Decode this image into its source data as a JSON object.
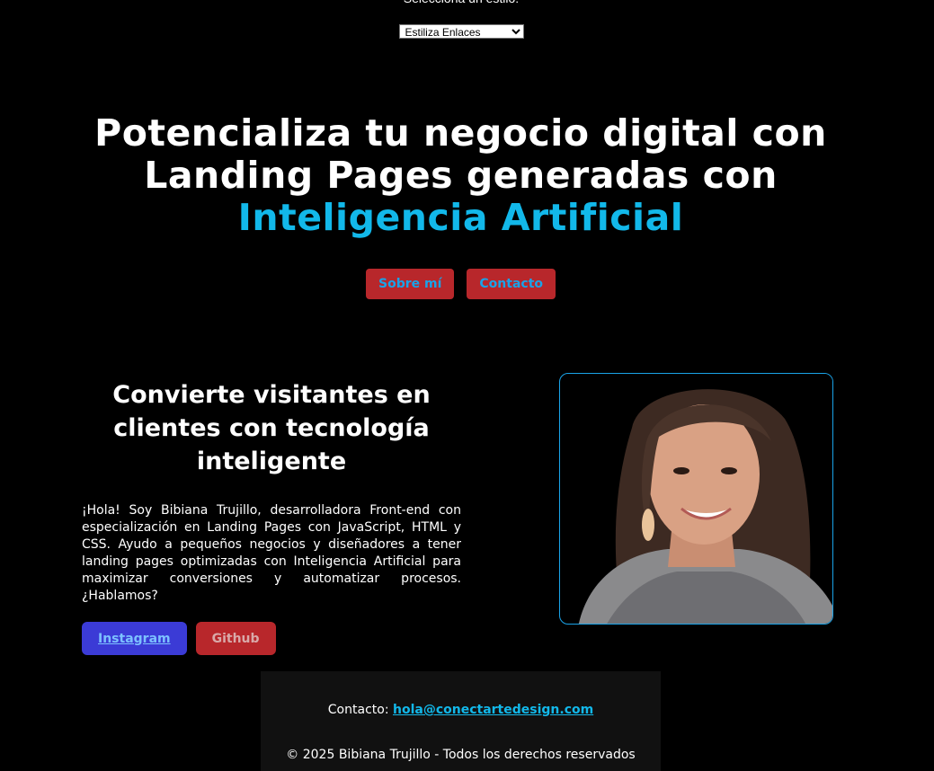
{
  "style_picker": {
    "label": "Selecciona un estilo:",
    "selected": "Estiliza Enlaces"
  },
  "hero": {
    "title_line1": "Potencializa tu negocio digital con",
    "title_line2": "Landing Pages generadas con",
    "title_accent": "Inteligencia Artificial",
    "buttons": [
      "Sobre mí",
      "Contacto"
    ]
  },
  "about": {
    "title": "Convierte visitantes en clientes con tecnología inteligente",
    "text": "¡Hola! Soy Bibiana Trujillo, desarrolladora Front-end con especialización en Landing Pages con JavaScript, HTML y CSS. Ayudo a pequeños negocios y diseñadores a tener landing pages optimizadas con Inteligencia Artificial para maximizar conversiones y automatizar procesos. ¿Hablamos?",
    "social": {
      "instagram": "Instagram",
      "github": "Github"
    }
  },
  "footer": {
    "contact_label": "Contacto:",
    "contact_email": "hola@conectartedesign.com",
    "copyright": "© 2025 Bibiana Trujillo - Todos los derechos reservados"
  },
  "colors": {
    "accent": "#12b8ea",
    "button_red": "#b8272b",
    "instagram_blue": "#3b3bd6",
    "frame_border": "#1aa3e8"
  }
}
